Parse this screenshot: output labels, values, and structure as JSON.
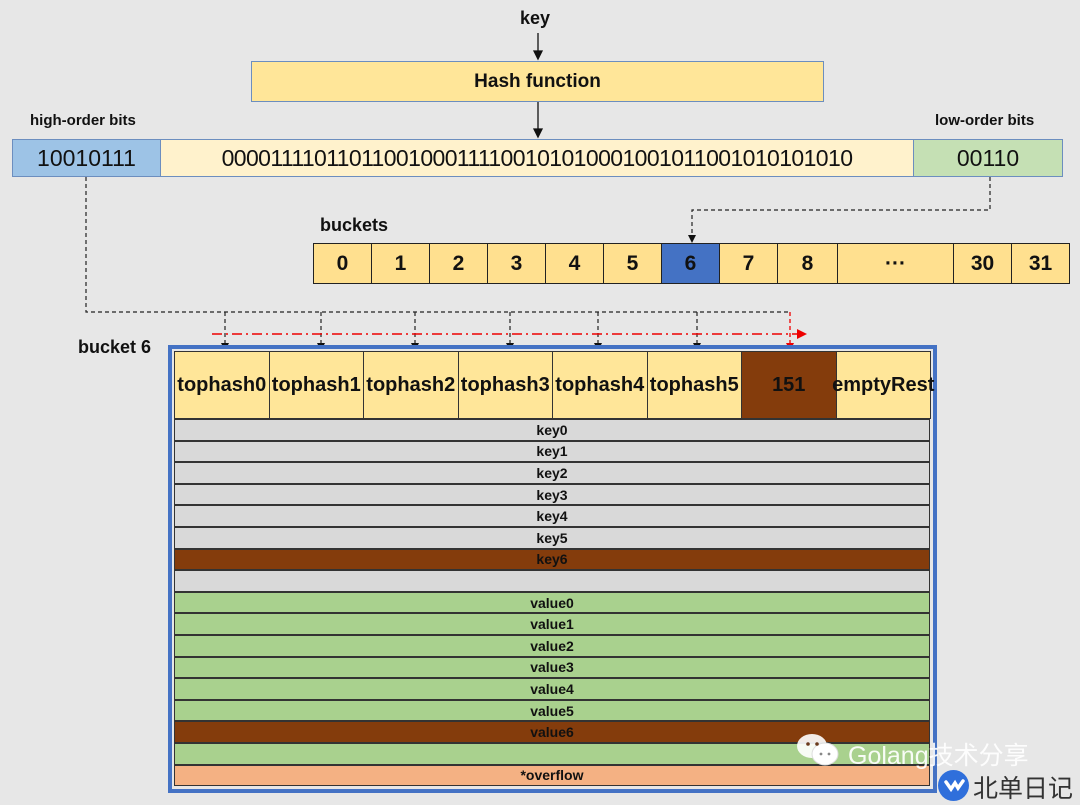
{
  "key_label": "key",
  "hash_function": "Hash function",
  "high_order_label": "high-order bits",
  "low_order_label": "low-order bits",
  "bits": {
    "high": "10010111",
    "middle": "00001111011011001000111100101010001001011001010101010",
    "low": "00110"
  },
  "buckets_label": "buckets",
  "buckets": [
    "0",
    "1",
    "2",
    "3",
    "4",
    "5",
    "6",
    "7",
    "8",
    "···",
    "30",
    "31"
  ],
  "selected_bucket": "6",
  "bucket6_label": "bucket 6",
  "tophash": [
    {
      "l1": "top",
      "l2": "hash0"
    },
    {
      "l1": "top",
      "l2": "hash1"
    },
    {
      "l1": "top",
      "l2": "hash2"
    },
    {
      "l1": "top",
      "l2": "hash3"
    },
    {
      "l1": "top",
      "l2": "hash4"
    },
    {
      "l1": "top",
      "l2": "hash5"
    },
    {
      "l1": "151",
      "l2": ""
    },
    {
      "l1": "empty",
      "l2": "Rest"
    }
  ],
  "rows": [
    {
      "text": "key0",
      "kind": "key"
    },
    {
      "text": "key1",
      "kind": "key"
    },
    {
      "text": "key2",
      "kind": "key"
    },
    {
      "text": "key3",
      "kind": "key"
    },
    {
      "text": "key4",
      "kind": "key"
    },
    {
      "text": "key5",
      "kind": "key"
    },
    {
      "text": "key6",
      "kind": "hit"
    },
    {
      "text": "",
      "kind": "key"
    },
    {
      "text": "value0",
      "kind": "value"
    },
    {
      "text": "value1",
      "kind": "value"
    },
    {
      "text": "value2",
      "kind": "value"
    },
    {
      "text": "value3",
      "kind": "value"
    },
    {
      "text": "value4",
      "kind": "value"
    },
    {
      "text": "value5",
      "kind": "value"
    },
    {
      "text": "value6",
      "kind": "hit"
    },
    {
      "text": "",
      "kind": "value"
    },
    {
      "text": "*overflow",
      "kind": "overflow"
    }
  ],
  "colors": {
    "key": "#d9d9d9",
    "value": "#a9d18e",
    "hit": "#843c0c",
    "overflow": "#f4b183",
    "selected": "#4472c4",
    "bucket_border": "#4472c4"
  },
  "watermark": {
    "channel": "Golang技术分享",
    "brand": "北单日记"
  }
}
